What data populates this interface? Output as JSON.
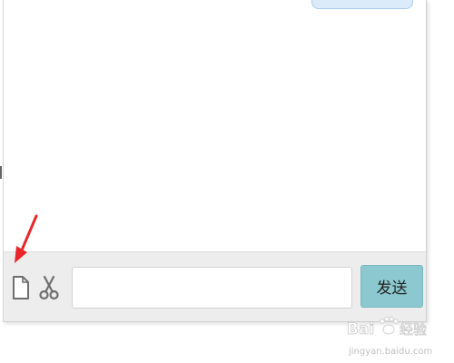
{
  "composer": {
    "input_value": "",
    "send_label": "发送"
  },
  "icons": {
    "file": "file-icon",
    "scissors": "scissors-icon"
  },
  "colors": {
    "send_button_bg": "#8cc8d0",
    "input_bar_bg": "#ededed",
    "bubble_bg": "#dcebfa",
    "arrow": "#e8262a"
  },
  "watermark": {
    "brand": "Bai",
    "brand_cn": "经验",
    "domain": "jingyan.baidu.com"
  }
}
